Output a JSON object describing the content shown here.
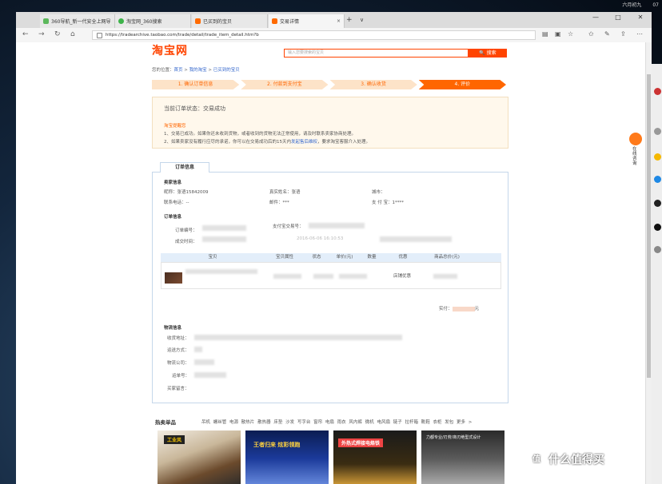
{
  "system": {
    "clock_date": "六月初九",
    "clock_time": "07"
  },
  "browser": {
    "tabs": [
      {
        "label": "360导航_新一代安全上网导",
        "color": "#5cb85c"
      },
      {
        "label": "淘宝网_360搜索",
        "color": "#3db34a"
      },
      {
        "label": "已买到的宝贝",
        "color": "#ff6a00"
      },
      {
        "label": "交易详情",
        "color": "#ff6a00"
      }
    ],
    "new_tab": "+",
    "tab_menu": "∨",
    "close_tab": "×",
    "window": {
      "minimize": "—",
      "maximize": "□",
      "close": "✕"
    },
    "url": "https://tradearchive.taobao.com/trade/detail/trade_item_detail.htm?b"
  },
  "header": {
    "logo": "淘宝网",
    "search_placeholder": "输入您要搜索的宝贝",
    "search_button": "🔍 搜索"
  },
  "breadcrumb": {
    "prefix": "您的位置：",
    "home": "首页",
    "my_taobao": "我的淘宝",
    "bought": "已买到的宝贝",
    "sep": " > "
  },
  "steps": [
    "1. 确认订单信息",
    "2. 付款到支付宝",
    "3. 确认收货",
    "4. 评价"
  ],
  "notice": {
    "status": "当前订单状态：交易成功",
    "reminder_title": "淘宝提醒您",
    "line1": "1、交易已成功。如果你还未收到货物，或者收到的货物无法正常使用，请及时联系卖家协商处理。",
    "line2_a": "2、如果卖家没有履行应尽的承诺，你可以在交易成功后的15天内",
    "line2_link": "发起售后维权",
    "line2_b": "，要求淘宝客服介入处理。"
  },
  "order_tab": "订单信息",
  "seller": {
    "title": "卖家信息",
    "nick_label": "昵称：",
    "nick": "张语15842009",
    "realname_label": "真实姓名：",
    "realname": "张语",
    "city_label": "城市：",
    "phone_label": "联系电话：",
    "phone": "--",
    "email_label": "邮件：",
    "email": "***",
    "alipay_label": "支 付 宝：",
    "alipay": "1****"
  },
  "order": {
    "title": "订单信息",
    "number_label": "订单编号：",
    "alipay_no_label": "支付宝交易号：",
    "deal_time_label": "成交时间：",
    "partial_time": "2016-06-06 16:10:53"
  },
  "table": {
    "headers": [
      "宝贝",
      "宝贝属性",
      "状态",
      "单价(元)",
      "数量",
      "优惠",
      "商品总价(元)"
    ],
    "promo": "店铺优惠"
  },
  "total": {
    "label": "实付：",
    "unit": "元"
  },
  "logistics": {
    "title": "物流信息",
    "address_label": "收货地址：",
    "method_label": "运送方式：",
    "company_label": "物流公司：",
    "waybill_label": "运单号：",
    "message_label": "买家留言："
  },
  "hot": {
    "title": "热卖单品",
    "categories": [
      "吊机",
      "螺丝管",
      "电源",
      "散热片",
      "散热器",
      "床垫",
      "沙发",
      "写字台",
      "窗帘",
      "电扇",
      "雨衣",
      "风内裤",
      "微机",
      "电风扇",
      "链子",
      "拉杆箱",
      "靴鞋",
      "衣柜",
      "发包"
    ],
    "more": "更多 >",
    "products": [
      {
        "badge": "工业风"
      },
      {
        "badge": "王者归来 炫彩领跑"
      },
      {
        "badge": "外热式焊接电烙铁"
      },
      {
        "badge": "力都专业/刃劳/商刃绝型式设计"
      }
    ]
  },
  "side_widget": {
    "label": "在线咨询"
  },
  "watermark": "什么值得买",
  "watermark_icon": "值"
}
